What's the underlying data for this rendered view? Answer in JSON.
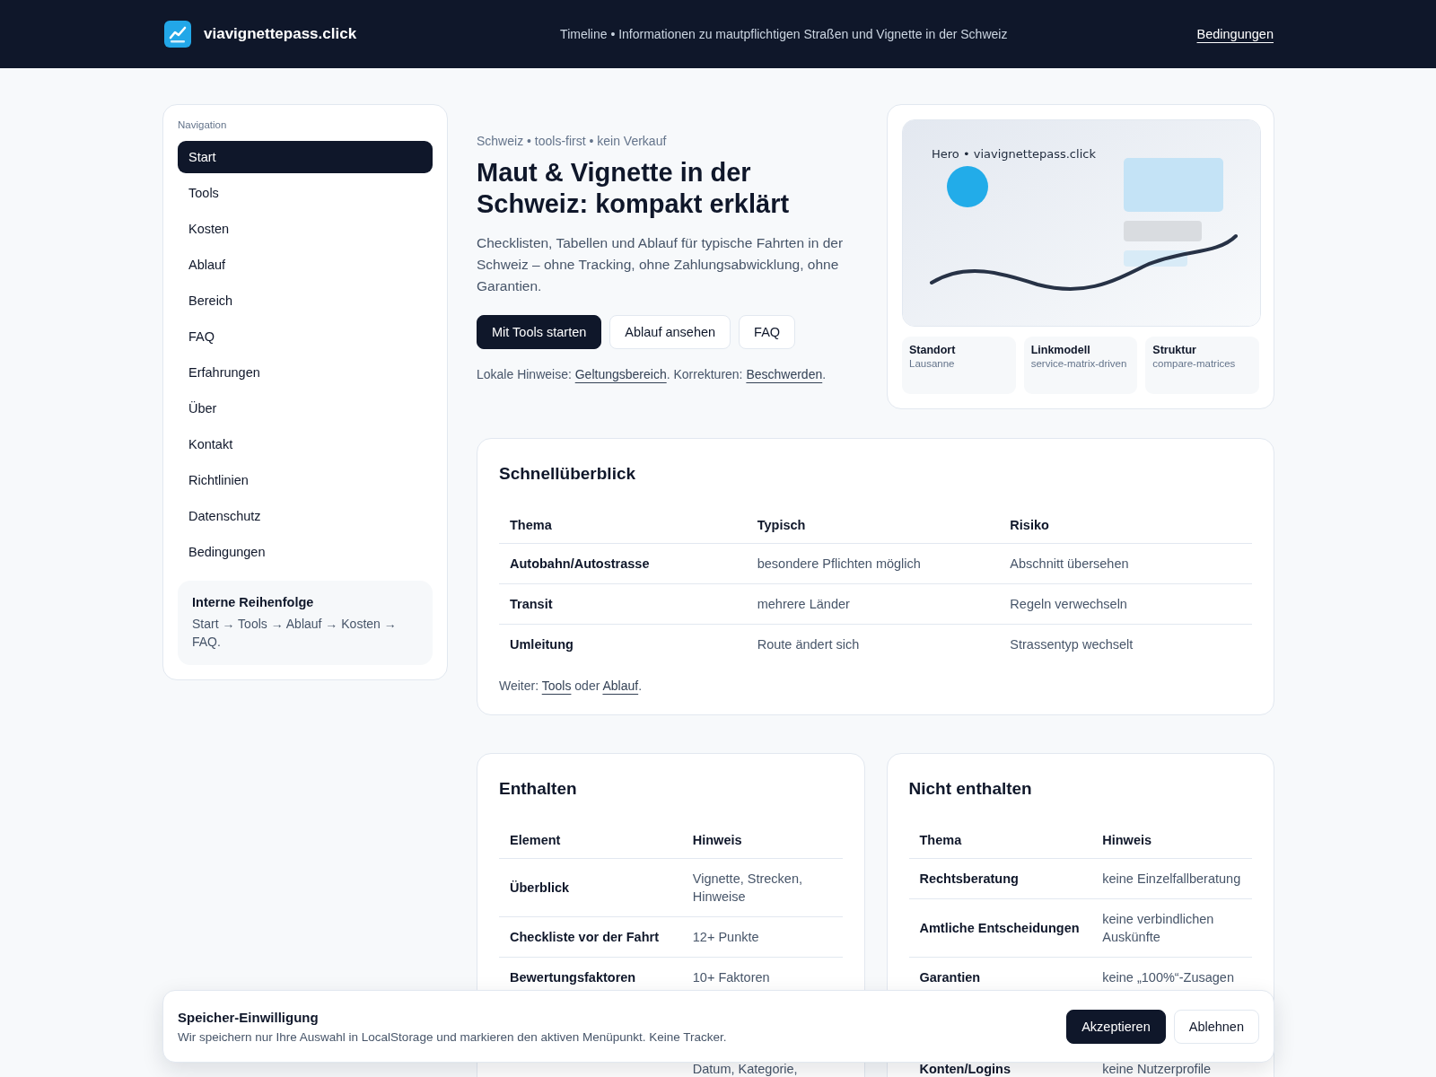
{
  "header": {
    "brand": "viavignettepass.click",
    "tagline": "Timeline • Informationen zu mautpflichtigen Straßen und Vignette in der Schweiz",
    "link": "Bedingungen"
  },
  "sidebar": {
    "heading": "Navigation",
    "items": [
      {
        "label": "Start",
        "selected": true
      },
      {
        "label": "Tools",
        "selected": false
      },
      {
        "label": "Kosten",
        "selected": false
      },
      {
        "label": "Ablauf",
        "selected": false
      },
      {
        "label": "Bereich",
        "selected": false
      },
      {
        "label": "FAQ",
        "selected": false
      },
      {
        "label": "Erfahrungen",
        "selected": false
      },
      {
        "label": "Über",
        "selected": false
      },
      {
        "label": "Kontakt",
        "selected": false
      },
      {
        "label": "Richtlinien",
        "selected": false
      },
      {
        "label": "Datenschutz",
        "selected": false
      },
      {
        "label": "Bedingungen",
        "selected": false
      }
    ],
    "note": {
      "title": "Interne Reihenfolge",
      "text": "Start → Tools → Ablauf → Kosten → FAQ."
    }
  },
  "hero": {
    "eyebrow": "Schweiz • tools-first • kein Verkauf",
    "title": "Maut & Vignette in der Schweiz: kompakt erklärt",
    "lead": "Checklisten, Tabellen und Ablauf für typische Fahrten in der Schweiz – ohne Tracking, ohne Zahlungsabwicklung, ohne Garantien.",
    "buttons": [
      {
        "label": "Mit Tools starten",
        "kind": "primary"
      },
      {
        "label": "Ablauf ansehen",
        "kind": "secondary"
      },
      {
        "label": "FAQ",
        "kind": "secondary"
      }
    ],
    "hint": [
      {
        "text": "Lokale Hinweise: ",
        "kind": "text"
      },
      {
        "text": "Geltungsbereich",
        "kind": "link"
      },
      {
        "text": ". Korrekturen: ",
        "kind": "text"
      },
      {
        "text": "Beschwerden",
        "kind": "link"
      },
      {
        "text": ".",
        "kind": "text"
      }
    ],
    "illustration": {
      "caption": "Hero • viavignettepass.click"
    },
    "facts": [
      {
        "label": "Standort",
        "value": "Lausanne"
      },
      {
        "label": "Linkmodell",
        "value": "service-matrix-driven"
      },
      {
        "label": "Struktur",
        "value": "compare-matrices"
      }
    ]
  },
  "overview": {
    "title": "Schnellüberblick",
    "columns": [
      "Thema",
      "Typisch",
      "Risiko"
    ],
    "rows": [
      [
        "Autobahn/Autostrasse",
        "besondere Pflichten möglich",
        "Abschnitt übersehen"
      ],
      [
        "Transit",
        "mehrere Länder",
        "Regeln verwechseln"
      ],
      [
        "Umleitung",
        "Route ändert sich",
        "Strassentyp wechselt"
      ]
    ],
    "more": [
      {
        "text": "Weiter: ",
        "kind": "text"
      },
      {
        "text": "Tools",
        "kind": "link"
      },
      {
        "text": " oder ",
        "kind": "text"
      },
      {
        "text": "Ablauf",
        "kind": "link"
      },
      {
        "text": ".",
        "kind": "text"
      }
    ]
  },
  "included": {
    "title": "Enthalten",
    "columns": [
      "Element",
      "Hinweis"
    ],
    "rows": [
      [
        "Überblick",
        "Vignette, Strecken, Hinweise"
      ],
      [
        "Checkliste vor der Fahrt",
        "12+ Punkte"
      ],
      [
        "Bewertungsfaktoren",
        "10+ Faktoren"
      ]
    ],
    "rows_below_banner": [
      {
        "hinweis": "Datum, Kategorie,"
      }
    ]
  },
  "excluded": {
    "title": "Nicht enthalten",
    "columns": [
      "Thema",
      "Hinweis"
    ],
    "rows": [
      [
        "Rechtsberatung",
        "keine Einzelfallberatung"
      ],
      [
        "Amtliche Entscheidungen",
        "keine verbindlichen Auskünfte"
      ],
      [
        "Garantien",
        "keine „100%“-Zusagen"
      ]
    ],
    "rows_below_banner": [
      {
        "thema": "Konten/Logins",
        "hinweis": "keine Nutzerprofile"
      }
    ]
  },
  "consent": {
    "title": "Speicher-Einwilligung",
    "text": "Wir speichern nur Ihre Auswahl in LocalStorage und markieren den aktiven Menüpunkt. Keine Tracker.",
    "buttons": [
      {
        "label": "Akzeptieren",
        "kind": "primary"
      },
      {
        "label": "Ablehnen",
        "kind": "secondary"
      }
    ]
  }
}
